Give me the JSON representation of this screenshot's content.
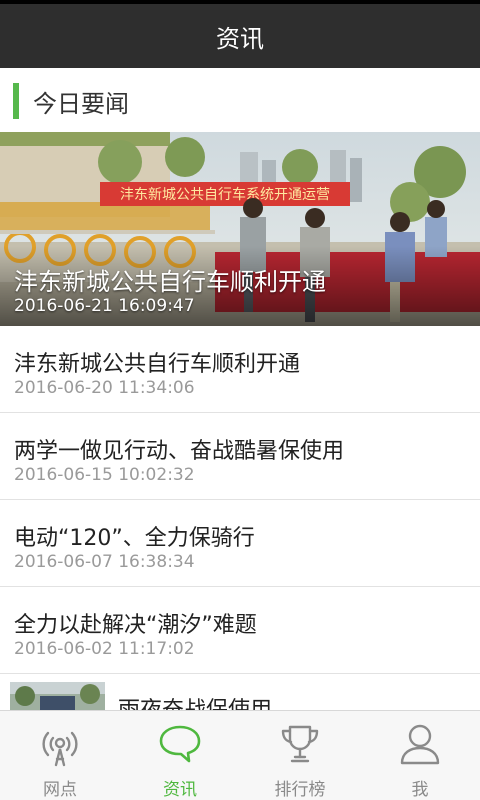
{
  "header": {
    "title": "资讯"
  },
  "section": {
    "title": "今日要闻"
  },
  "hero": {
    "title": "沣东新城公共自行车顺利开通",
    "time": "2016-06-21 16:09:47",
    "banner_text": "沣东新城公共自行车系统开通运营"
  },
  "news": [
    {
      "title": "沣东新城公共自行车顺利开通",
      "time": "2016-06-20 11:34:06"
    },
    {
      "title": "两学一做见行动、奋战酷暑保使用",
      "time": "2016-06-15 10:02:32"
    },
    {
      "title": "电动“120”、全力保骑行",
      "time": "2016-06-07 16:38:34"
    },
    {
      "title": "全力以赴解决“潮汐”难题",
      "time": "2016-06-02 11:17:02"
    }
  ],
  "thumb_news": {
    "title": "雨夜奋战保使用"
  },
  "tabs": [
    {
      "label": "网点",
      "icon": "station-icon",
      "active": false
    },
    {
      "label": "资讯",
      "icon": "chat-bubble-icon",
      "active": true
    },
    {
      "label": "排行榜",
      "icon": "trophy-icon",
      "active": false
    },
    {
      "label": "我",
      "icon": "user-icon",
      "active": false
    }
  ],
  "colors": {
    "header_bg": "#2e2e2e",
    "accent": "#56b84c",
    "tab_active": "#4fb83f",
    "tab_inactive": "#8a8a8a"
  }
}
